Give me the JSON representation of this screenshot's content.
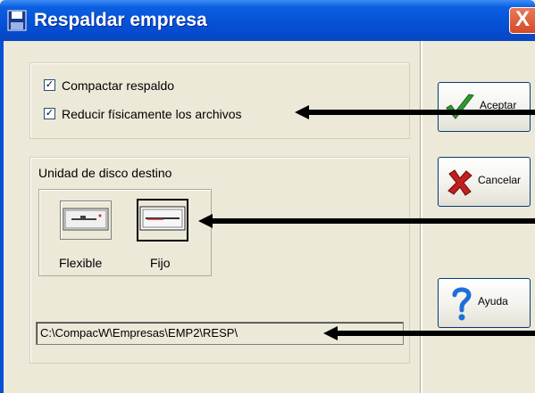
{
  "window": {
    "title": "Respaldar empresa",
    "close_glyph": "X"
  },
  "options": {
    "compact": {
      "label": "Compactar respaldo",
      "checked": true
    },
    "reduce": {
      "label": "Reducir físicamente los archivos",
      "checked": true
    }
  },
  "destination": {
    "group_label": "Unidad de disco destino",
    "drives": [
      {
        "label": "Flexible",
        "selected": false,
        "icon": "floppy-drive-icon"
      },
      {
        "label": "Fijo",
        "selected": true,
        "icon": "hard-drive-icon"
      }
    ],
    "path": "C:\\CompacW\\Empresas\\EMP2\\RESP\\"
  },
  "buttons": {
    "accept": {
      "label": "Aceptar",
      "icon": "checkmark-icon",
      "color": "#2E9C2E"
    },
    "cancel": {
      "label": "Cancelar",
      "icon": "x-icon",
      "color": "#C02020"
    },
    "help": {
      "label": "Ayuda",
      "icon": "question-icon",
      "color": "#1E6FD8"
    }
  },
  "colors": {
    "titlebar": "#0550D6",
    "face": "#ECE9D8",
    "arrow": "#000000"
  }
}
